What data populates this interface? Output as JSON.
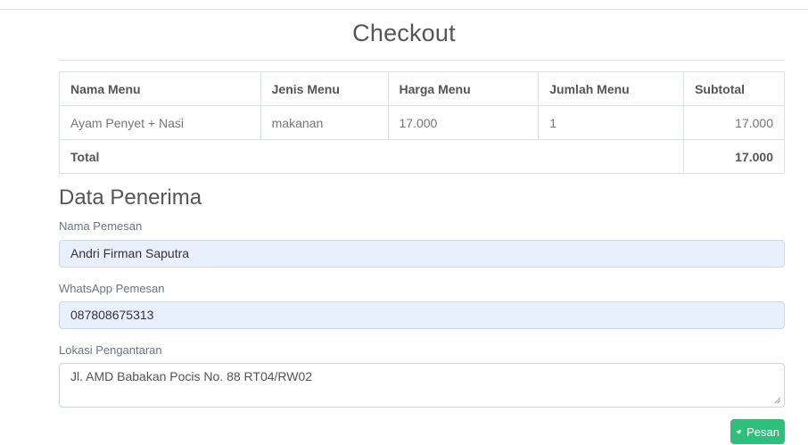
{
  "page": {
    "title": "Checkout"
  },
  "order_table": {
    "headers": [
      "Nama Menu",
      "Jenis Menu",
      "Harga Menu",
      "Jumlah Menu",
      "Subtotal"
    ],
    "rows": [
      {
        "nama": "Ayam Penyet + Nasi",
        "jenis": "makanan",
        "harga": "17.000",
        "jumlah": "1",
        "subtotal": "17.000"
      }
    ],
    "total_label": "Total",
    "total_value": "17.000"
  },
  "recipient": {
    "section_title": "Data Penerima",
    "name_label": "Nama Pemesan",
    "name_value": "Andri Firman Saputra",
    "whatsapp_label": "WhatsApp Pemesan",
    "whatsapp_value": "087808675313",
    "location_label": "Lokasi Pengantaran",
    "location_value": "Jl. AMD Babakan Pocis No. 88 RT04/RW02"
  },
  "actions": {
    "submit_label": "Pesan",
    "submit_icon": "paper-plane-icon",
    "accent": "#2ec07a"
  }
}
